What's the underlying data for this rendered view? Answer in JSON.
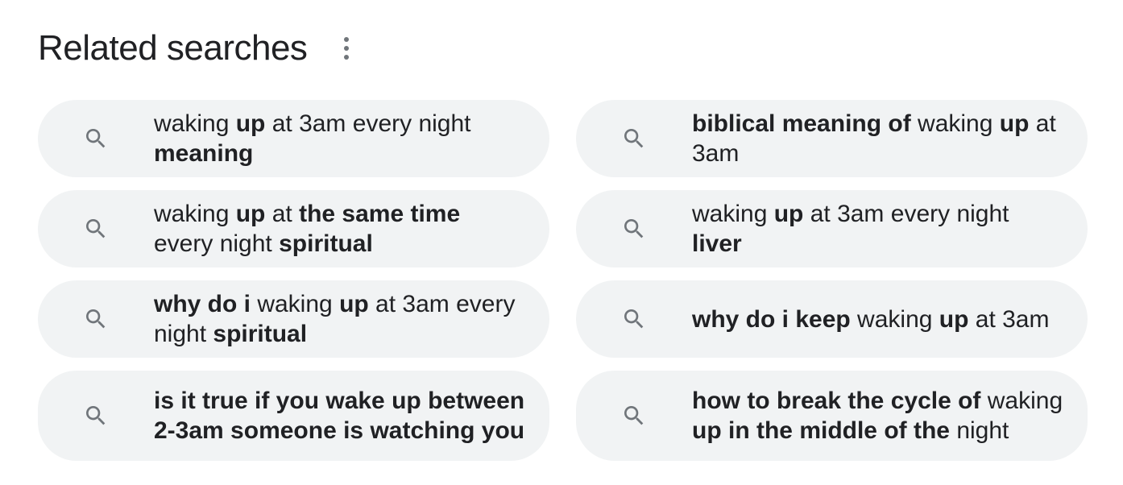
{
  "related": {
    "title": "Related searches",
    "more_icon": "more-vert-icon",
    "search_icon": "search-icon",
    "items": [
      {
        "text": "waking up at 3am every night meaning",
        "segments": [
          {
            "t": "waking ",
            "b": false
          },
          {
            "t": "up",
            "b": true
          },
          {
            "t": " at 3am every night ",
            "b": false
          },
          {
            "t": "meaning",
            "b": true
          }
        ]
      },
      {
        "text": "biblical meaning of waking up at 3am",
        "segments": [
          {
            "t": "biblical meaning of",
            "b": true
          },
          {
            "t": " waking ",
            "b": false
          },
          {
            "t": "up",
            "b": true
          },
          {
            "t": " at 3am",
            "b": false
          }
        ]
      },
      {
        "text": "waking up at the same time every night spiritual",
        "segments": [
          {
            "t": "waking ",
            "b": false
          },
          {
            "t": "up",
            "b": true
          },
          {
            "t": " at ",
            "b": false
          },
          {
            "t": "the same time",
            "b": true
          },
          {
            "t": " every night ",
            "b": false
          },
          {
            "t": "spiritual",
            "b": true
          }
        ]
      },
      {
        "text": "waking up at 3am every night liver",
        "segments": [
          {
            "t": "waking ",
            "b": false
          },
          {
            "t": "up",
            "b": true
          },
          {
            "t": " at 3am every night ",
            "b": false
          },
          {
            "t": "liver",
            "b": true
          }
        ]
      },
      {
        "text": "why do i waking up at 3am every night spiritual",
        "segments": [
          {
            "t": "why do i",
            "b": true
          },
          {
            "t": " waking ",
            "b": false
          },
          {
            "t": "up",
            "b": true
          },
          {
            "t": " at 3am every night ",
            "b": false
          },
          {
            "t": "spiritual",
            "b": true
          }
        ]
      },
      {
        "text": "why do i keep waking up at 3am",
        "segments": [
          {
            "t": "why do i keep",
            "b": true
          },
          {
            "t": " waking ",
            "b": false
          },
          {
            "t": "up",
            "b": true
          },
          {
            "t": " at 3am",
            "b": false
          }
        ]
      },
      {
        "text": "is it true if you wake up between 2-3am someone is watching you",
        "segments": [
          {
            "t": "is it true if you wake up between 2-3am someone is watching you",
            "b": true
          }
        ]
      },
      {
        "text": "how to break the cycle of waking up in the middle of the night",
        "segments": [
          {
            "t": "how to break the cycle of",
            "b": true
          },
          {
            "t": " waking ",
            "b": false
          },
          {
            "t": "up in the middle of the",
            "b": true
          },
          {
            "t": " night",
            "b": false
          }
        ]
      }
    ]
  }
}
